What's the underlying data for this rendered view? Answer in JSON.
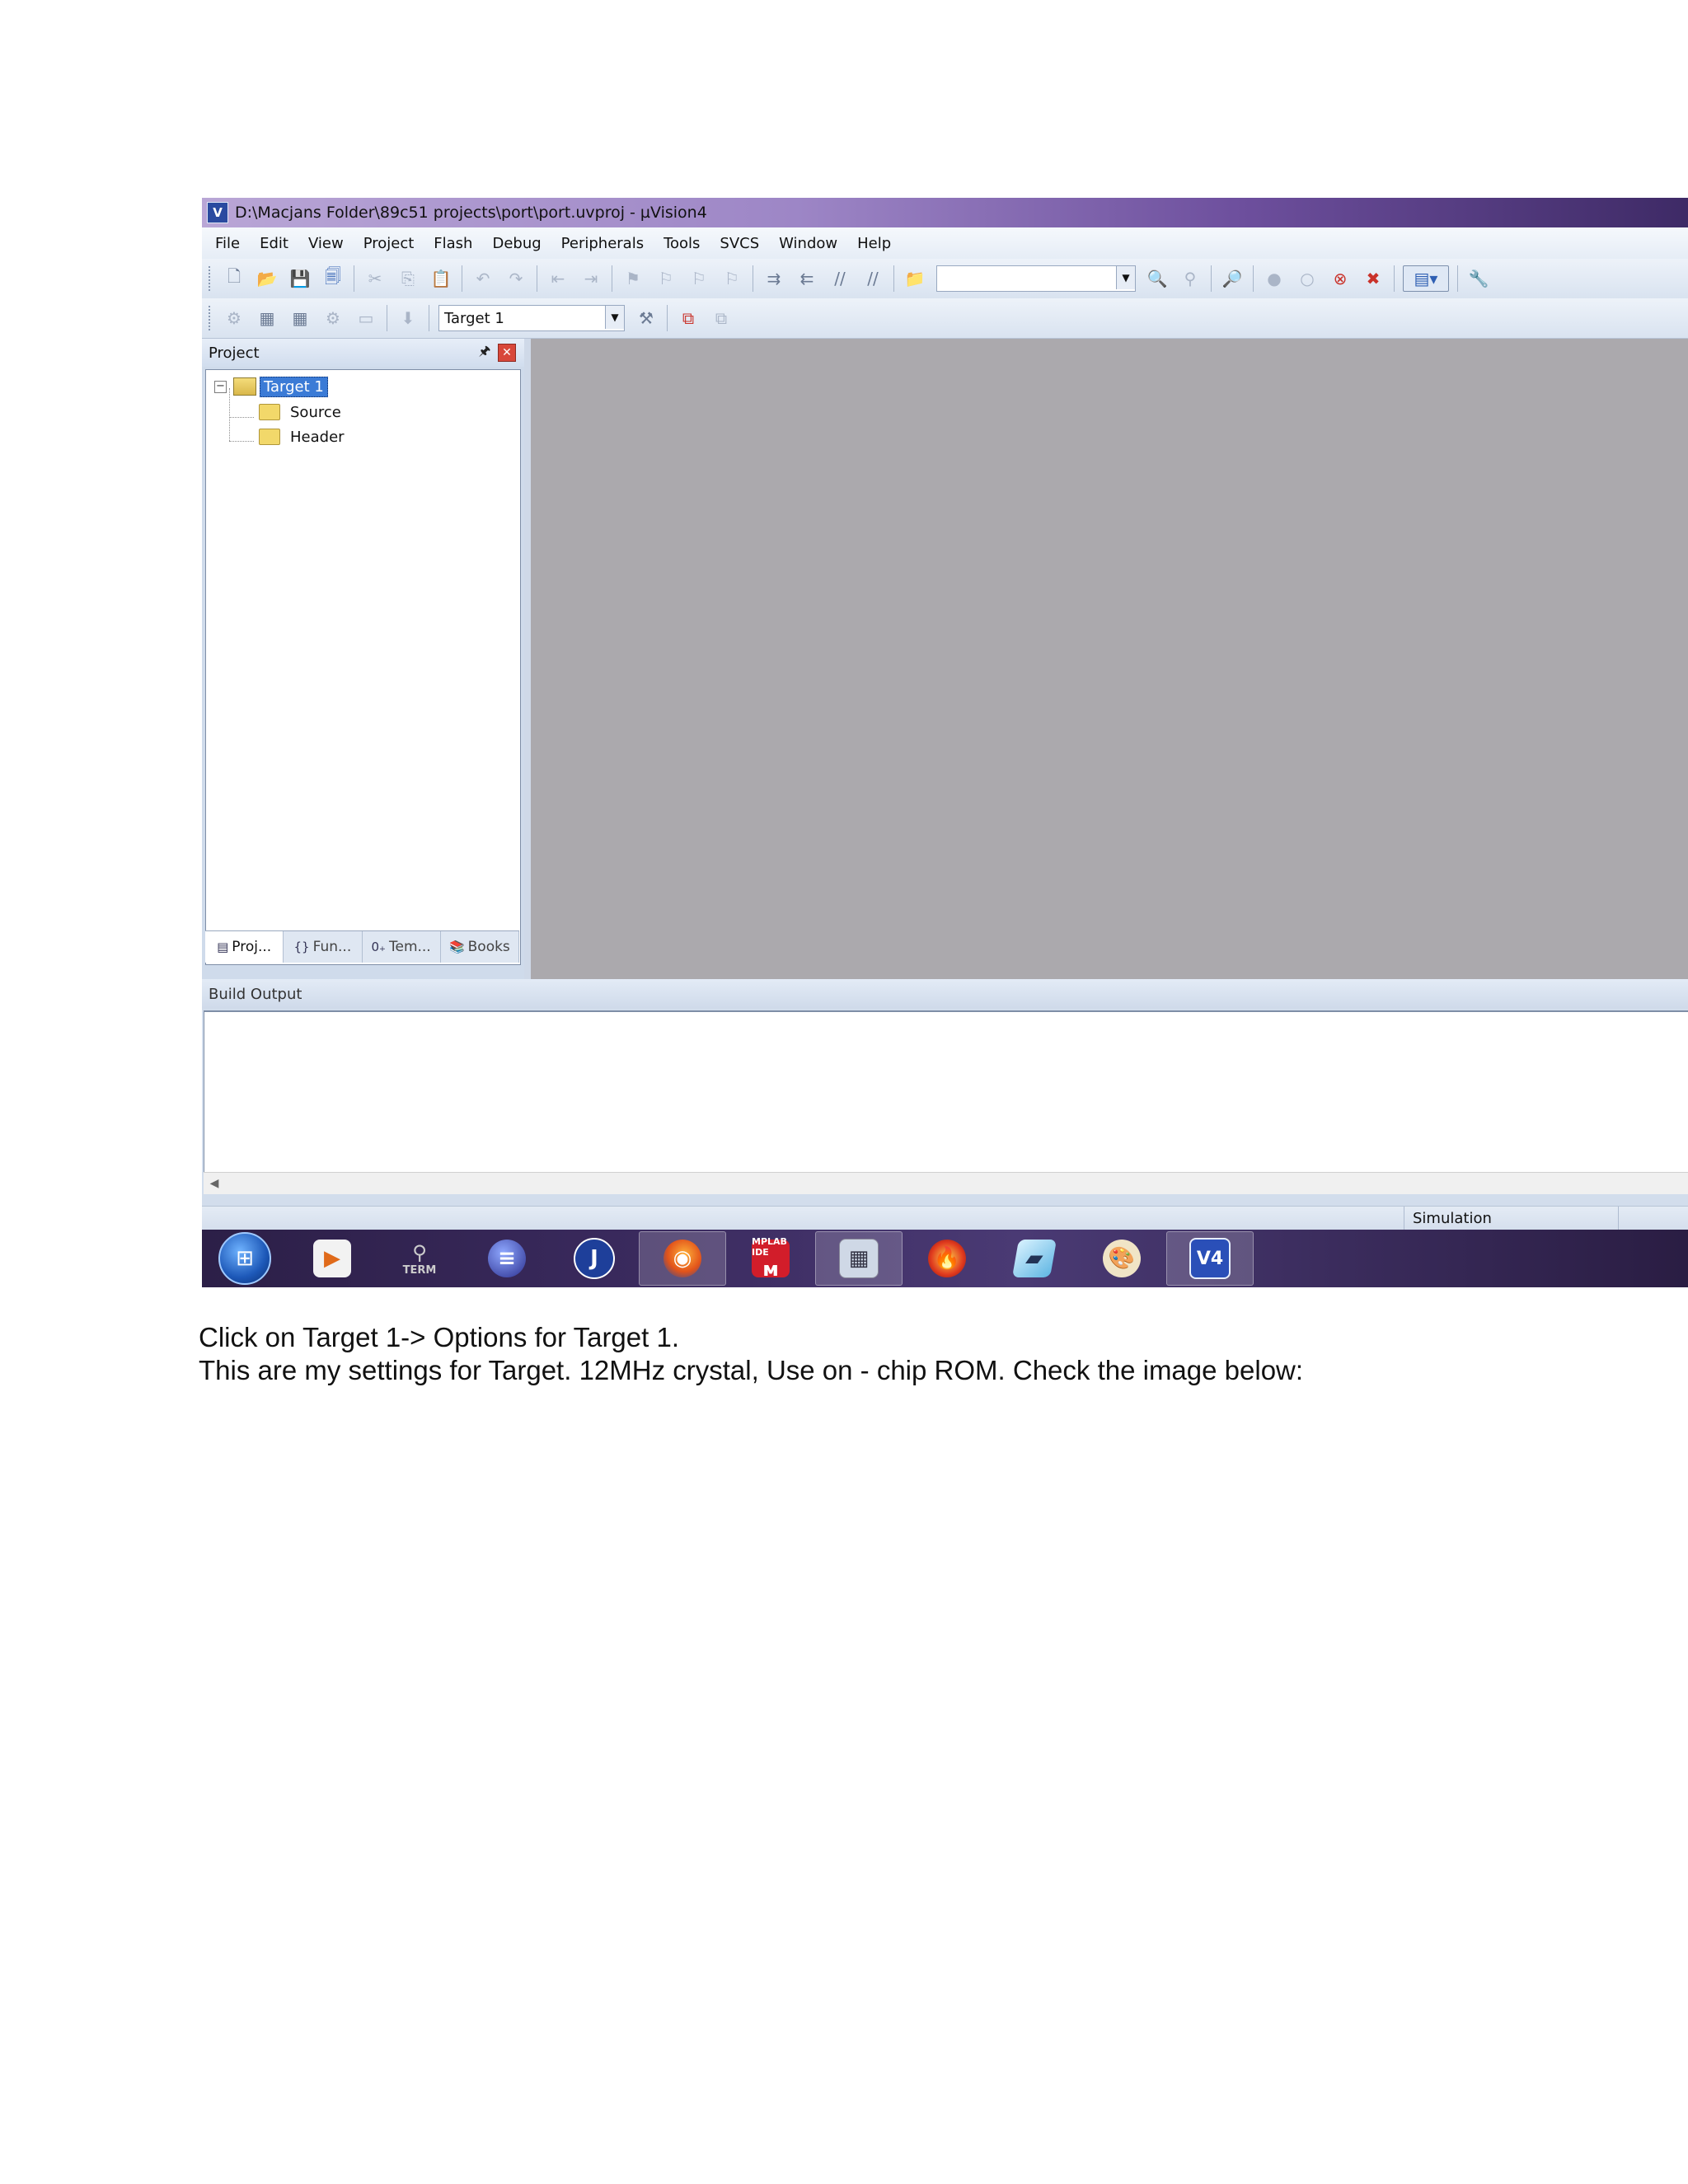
{
  "window": {
    "title": "D:\\Macjans Folder\\89c51 projects\\port\\port.uvproj - µVision4",
    "app_icon": "V"
  },
  "menu": [
    "File",
    "Edit",
    "View",
    "Project",
    "Flash",
    "Debug",
    "Peripherals",
    "Tools",
    "SVCS",
    "Window",
    "Help"
  ],
  "toolbar": {
    "find_combo_value": "",
    "target_combo_value": "Target 1"
  },
  "project_panel": {
    "title": "Project",
    "tree": {
      "root": "Target 1",
      "children": [
        "Source",
        "Header"
      ]
    },
    "tabs": [
      {
        "icon": "project-tab-icon",
        "label": "Proj..."
      },
      {
        "icon": "functions-tab-icon",
        "label": "Fun..."
      },
      {
        "icon": "templates-tab-icon",
        "label": "Tem..."
      },
      {
        "icon": "books-tab-icon",
        "label": "Books"
      }
    ]
  },
  "build_output": {
    "title": "Build Output"
  },
  "status_bar": {
    "mode": "Simulation"
  },
  "taskbar": {
    "items": [
      {
        "icon": "windows-start-icon"
      },
      {
        "icon": "media-player-icon"
      },
      {
        "icon": "terminal-icon",
        "label": "TERM"
      },
      {
        "icon": "eclipse-icon"
      },
      {
        "icon": "jedit-icon"
      },
      {
        "icon": "firefox-icon",
        "active": true
      },
      {
        "icon": "mplab-icon",
        "label": "MPLAB IDE"
      },
      {
        "icon": "calculator-icon",
        "active": true
      },
      {
        "icon": "burner-icon"
      },
      {
        "icon": "notepad-icon"
      },
      {
        "icon": "paint-icon"
      },
      {
        "icon": "uvision4-icon",
        "active": true,
        "label": "V4"
      }
    ]
  },
  "caption": {
    "line1": "Click on Target 1-> Options for Target 1.",
    "line2": "This are my settings for Target. 12MHz crystal, Use on - chip ROM. Check the image below:"
  },
  "colors": {
    "editor_bg": "#aba9ad",
    "selection": "#3b7bd6",
    "taskbar": "#3a2a5e"
  }
}
